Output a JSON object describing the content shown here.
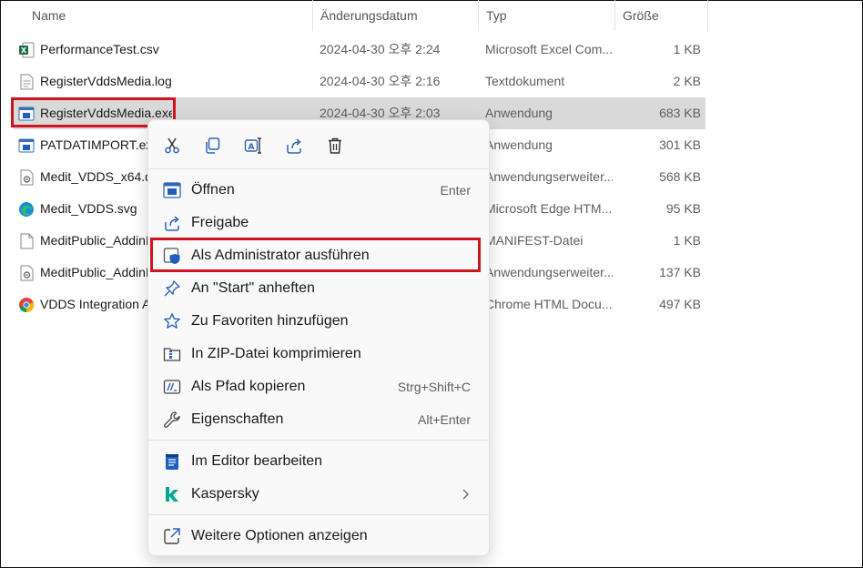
{
  "columns": {
    "name": "Name",
    "date": "Änderungsdatum",
    "type": "Typ",
    "size": "Größe"
  },
  "files": [
    {
      "name": "PerformanceTest.csv",
      "date": "2024-04-30 오후 2:24",
      "type": "Microsoft Excel Com...",
      "size": "1 KB",
      "icon": "excel-csv-icon"
    },
    {
      "name": "RegisterVddsMedia.log",
      "date": "2024-04-30 오후 2:16",
      "type": "Textdokument",
      "size": "2 KB",
      "icon": "text-document-icon"
    },
    {
      "name": "RegisterVddsMedia.exe",
      "date": "2024-04-30 오후 2:03",
      "type": "Anwendung",
      "size": "683 KB",
      "icon": "application-icon",
      "selected": true
    },
    {
      "name": "PATDATIMPORT.exe",
      "date": "",
      "type": "Anwendung",
      "size": "301 KB",
      "icon": "application-icon"
    },
    {
      "name": "Medit_VDDS_x64.dll",
      "date": "",
      "type": "Anwendungserweiter...",
      "size": "568 KB",
      "icon": "dll-file-icon"
    },
    {
      "name": "Medit_VDDS.svg",
      "date": "",
      "type": "Microsoft Edge HTM...",
      "size": "95 KB",
      "icon": "edge-icon"
    },
    {
      "name": "MeditPublic_AddinB",
      "date": "",
      "type": "MANIFEST-Datei",
      "size": "1 KB",
      "icon": "blank-file-icon"
    },
    {
      "name": "MeditPublic_AddinB",
      "date": "",
      "type": "Anwendungserweiter...",
      "size": "137 KB",
      "icon": "dll-file-icon"
    },
    {
      "name": "VDDS Integration A",
      "date": "",
      "type": "Chrome HTML Docu...",
      "size": "497 KB",
      "icon": "chrome-icon"
    }
  ],
  "context_menu": {
    "toolbar": [
      "cut-icon",
      "copy-icon",
      "rename-icon",
      "share-icon",
      "delete-icon"
    ],
    "items": [
      {
        "label": "Öffnen",
        "shortcut": "Enter",
        "icon": "open-app-icon"
      },
      {
        "label": "Freigabe",
        "shortcut": "",
        "icon": "share-icon"
      },
      {
        "label": "Als Administrator ausführen",
        "shortcut": "",
        "icon": "admin-shield-icon",
        "highlighted": true
      },
      {
        "label": "An \"Start\" anheften",
        "shortcut": "",
        "icon": "pin-icon"
      },
      {
        "label": "Zu Favoriten hinzufügen",
        "shortcut": "",
        "icon": "star-icon"
      },
      {
        "label": "In ZIP-Datei komprimieren",
        "shortcut": "",
        "icon": "zip-folder-icon"
      },
      {
        "label": "Als Pfad kopieren",
        "shortcut": "Strg+Shift+C",
        "icon": "copy-path-icon"
      },
      {
        "label": "Eigenschaften",
        "shortcut": "Alt+Enter",
        "icon": "wrench-icon"
      },
      {
        "label": "Im Editor bearbeiten",
        "shortcut": "",
        "icon": "notepad-icon"
      },
      {
        "label": "Kaspersky",
        "shortcut": "",
        "icon": "kaspersky-icon",
        "submenu": true
      },
      {
        "label": "Weitere Optionen anzeigen",
        "shortcut": "",
        "icon": "more-options-icon"
      }
    ]
  },
  "colors": {
    "highlight_border": "#d0141f",
    "selected_row": "#d9d9d9",
    "menu_bg": "#f9f9f9"
  }
}
